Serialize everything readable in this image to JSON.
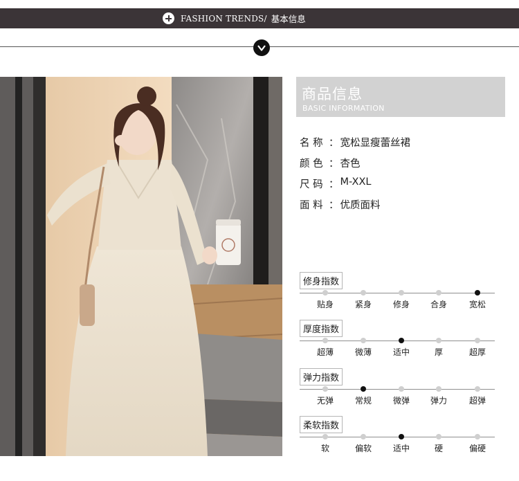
{
  "banner": {
    "title_en": "FASHION TRENDS/",
    "title_cn": "基本信息"
  },
  "info": {
    "title_cn": "商品信息",
    "title_en": "BASIC INFORMATION"
  },
  "specs": [
    {
      "key": "名 称",
      "value": "宽松显瘦蕾丝裙"
    },
    {
      "key": "颜 色",
      "value": "杏色"
    },
    {
      "key": "尺 码",
      "value": "M-XXL"
    },
    {
      "key": "面 料",
      "value": "优质面料"
    }
  ],
  "scales": [
    {
      "category": "修身指数",
      "options": [
        "贴身",
        "紧身",
        "修身",
        "合身",
        "宽松"
      ],
      "selected_index": 4
    },
    {
      "category": "厚度指数",
      "options": [
        "超薄",
        "微薄",
        "适中",
        "厚",
        "超厚"
      ],
      "selected_index": 2
    },
    {
      "category": "弹力指数",
      "options": [
        "无弹",
        "常规",
        "微弹",
        "弹力",
        "超弹"
      ],
      "selected_index": 1
    },
    {
      "category": "柔软指数",
      "options": [
        "软",
        "偏软",
        "适中",
        "硬",
        "偏硬"
      ],
      "selected_index": 2
    }
  ],
  "colors": {
    "banner_bg": "#3b3437",
    "header_bg": "#d2d2d2",
    "active_dot": "#111111",
    "inactive_dot": "#cfcfcf"
  },
  "icons": {
    "banner": "plus-circle-icon",
    "divider": "chevron-down-icon"
  }
}
